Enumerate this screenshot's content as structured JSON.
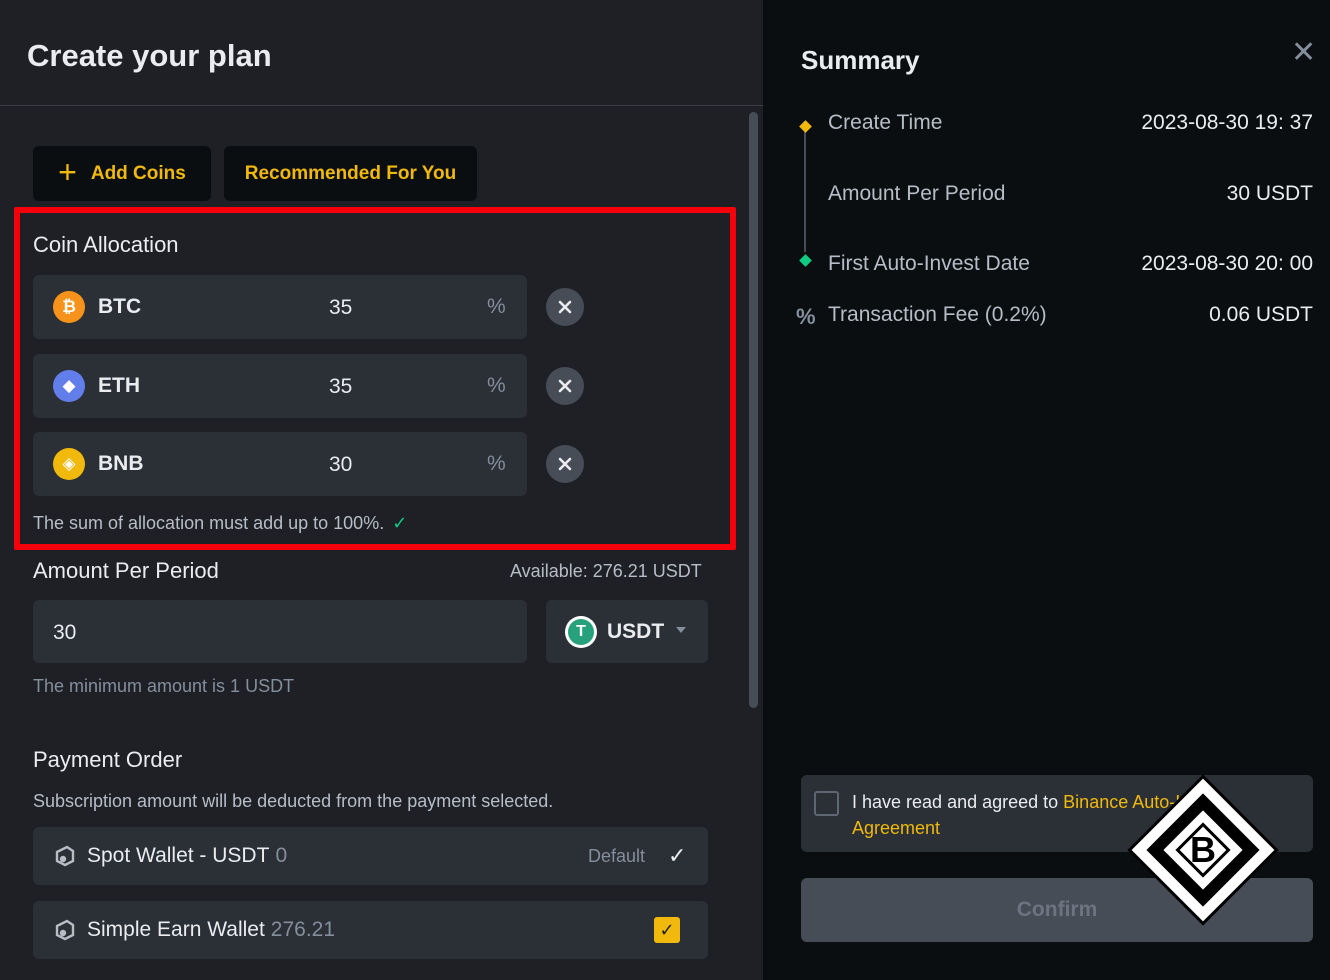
{
  "panel": {
    "title": "Create your plan",
    "add_coins_label": "Add Coins",
    "recommended_label": "Recommended For You"
  },
  "allocation": {
    "heading": "Coin Allocation",
    "coins": [
      {
        "symbol": "BTC",
        "value": "35",
        "unit": "%",
        "icon_glyph": "₿",
        "color": "#f7931a"
      },
      {
        "symbol": "ETH",
        "value": "35",
        "unit": "%",
        "icon_glyph": "◆",
        "color": "#627eea"
      },
      {
        "symbol": "BNB",
        "value": "30",
        "unit": "%",
        "icon_glyph": "◈",
        "color": "#f0b90b"
      }
    ],
    "note": "The sum of allocation must add up to 100%."
  },
  "amount": {
    "heading": "Amount Per Period",
    "available": "Available: 276.21 USDT",
    "value": "30",
    "currency": "USDT",
    "currency_glyph": "T",
    "min_note": "The minimum amount is 1 USDT"
  },
  "payment": {
    "heading": "Payment Order",
    "description": "Subscription amount will be deducted from the payment selected.",
    "wallets": [
      {
        "name": "Spot Wallet - USDT",
        "amount": "0",
        "tag": "Default",
        "check": "✓"
      },
      {
        "name": "Simple Earn Wallet",
        "amount": "276.21",
        "check": "✓"
      }
    ]
  },
  "summary": {
    "title": "Summary",
    "close_glyph": "✕",
    "rows": [
      {
        "label": "Create Time",
        "value": "2023-08-30 19: 37"
      },
      {
        "label": "Amount Per Period",
        "value": "30 USDT"
      },
      {
        "label": "First Auto-Invest Date",
        "value": "2023-08-30 20: 00"
      },
      {
        "label": "Transaction Fee (0.2%)",
        "value": "0.06 USDT"
      }
    ],
    "fee_glyph": "%",
    "agree_text": "I have read and agreed to ",
    "agree_link": "Binance Auto-Invest Agreement",
    "confirm_label": "Confirm",
    "logo_letter": "B"
  },
  "colors": {
    "accent": "#f0b90b",
    "success": "#0ecb81",
    "highlight": "#f5000a",
    "panel_bg": "#1e2026",
    "field_bg": "#2b2f36"
  }
}
